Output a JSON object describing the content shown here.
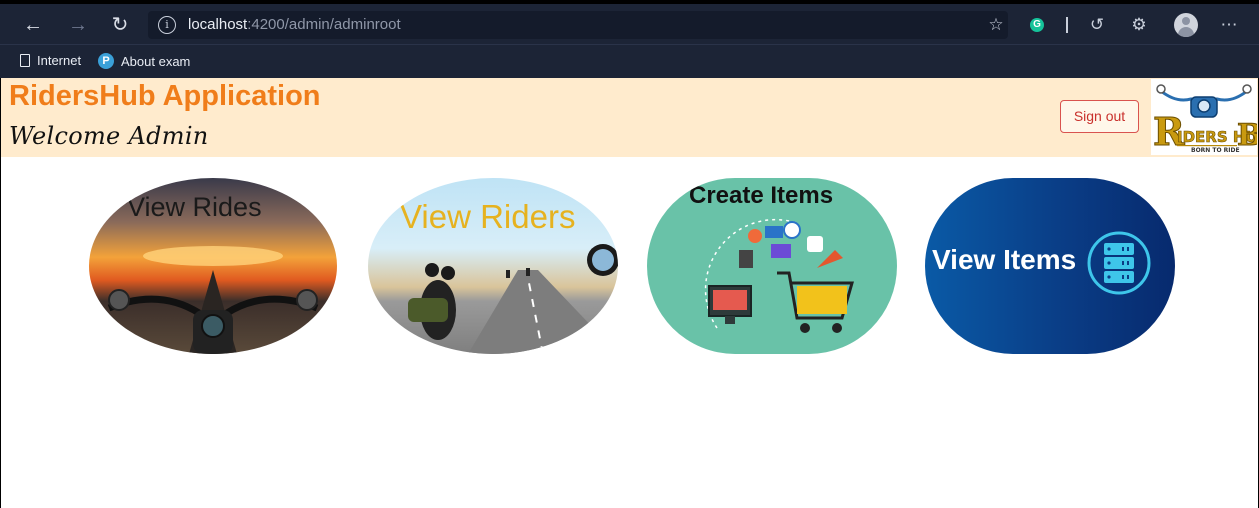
{
  "browser": {
    "url_host": "localhost",
    "url_rest": ":4200/admin/adminroot",
    "bookmarks": [
      {
        "label": "Internet",
        "icon": "page-icon"
      },
      {
        "label": "About exam",
        "icon": "pearson-icon"
      }
    ]
  },
  "header": {
    "app_title": "RidersHub Application",
    "welcome": "Welcome Admin",
    "signout_label": "Sign out",
    "logo_text": "RIDERS HUB",
    "logo_tagline": "BORN TO RIDE",
    "colors": {
      "header_bg": "#ffebcd",
      "title": "#f07d1a",
      "signout_border": "#d9534f"
    }
  },
  "tiles": [
    {
      "label": "View Rides",
      "image": "sunset-motorcycle-road"
    },
    {
      "label": "View Riders",
      "image": "riders-on-highway"
    },
    {
      "label": "Create Items",
      "image": "shopping-cart-ecommerce-icon"
    },
    {
      "label": "View Items",
      "image": "server-stack-icon"
    }
  ]
}
